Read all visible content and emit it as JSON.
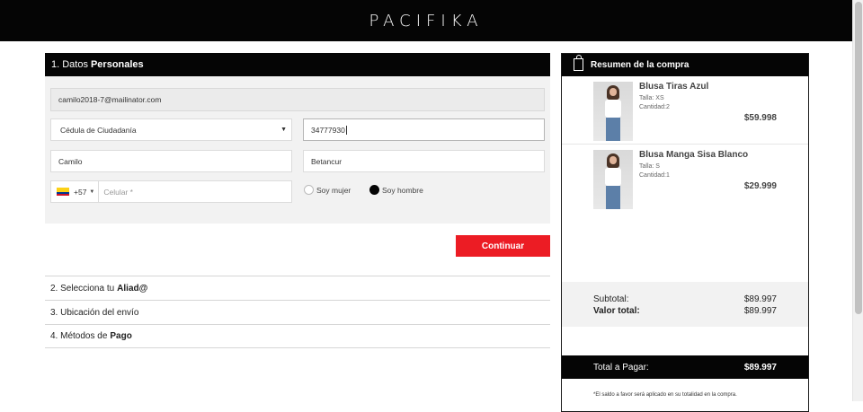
{
  "header": {
    "logo": "PACIFIKA"
  },
  "step1": {
    "number_label": "1. Datos",
    "bold_label": "Personales",
    "email": "camilo2018-7@mailinator.com",
    "document_type": "Cédula de Ciudadanía",
    "document_number": "34777930",
    "first_name": "Camilo",
    "last_name": "Betancur",
    "dial_code": "+57",
    "phone_placeholder": "Celular *",
    "gender_female": "Soy mujer",
    "gender_male": "Soy hombre",
    "gender_selected": "male",
    "continue_label": "Continuar"
  },
  "steps": [
    {
      "label": "2. Selecciona tu",
      "bold": "Aliad@"
    },
    {
      "label": "3. Ubicación del envío",
      "bold": ""
    },
    {
      "label": "4. Métodos de",
      "bold": "Pago"
    }
  ],
  "summary": {
    "title": "Resumen de la compra",
    "products": [
      {
        "name": "Blusa Tiras Azul",
        "size": "Talla: XS",
        "quantity": "Cantidad:2",
        "price": "$59.998"
      },
      {
        "name": "Blusa Manga Sisa Blanco",
        "size": "Talla: S",
        "quantity": "Cantidad:1",
        "price": "$29.999"
      }
    ],
    "subtotal_label": "Subtotal:",
    "subtotal_value": "$89.997",
    "total_value_label": "Valor total:",
    "total_value": "$89.997",
    "pay_label": "Total a Pagar:",
    "pay_value": "$89.997",
    "note": "*El saldo a favor será aplicado en su totalidad en la compra."
  },
  "colors": {
    "header_bg": "#050505",
    "accent": "#ec1c24",
    "form_bg": "#f2f2f2"
  }
}
